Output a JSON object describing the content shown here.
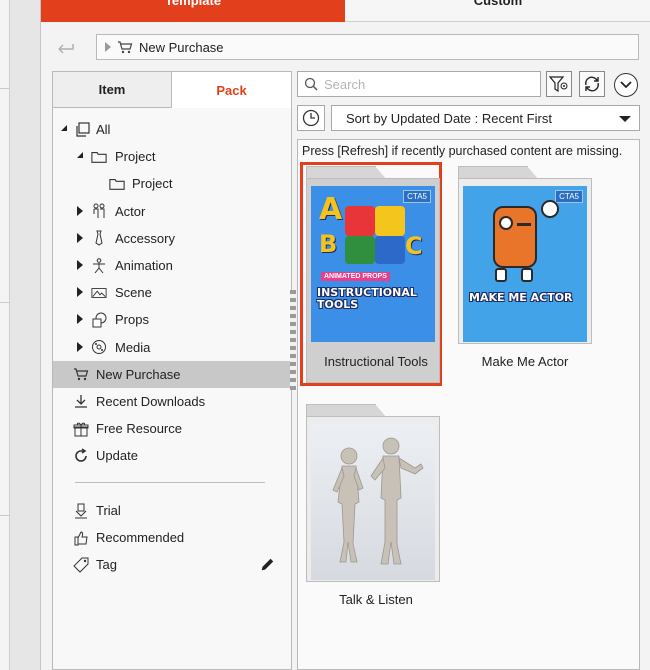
{
  "top_tabs": {
    "template": "Template",
    "custom": "Custom"
  },
  "address": {
    "path": "New Purchase"
  },
  "pane_tabs": {
    "item": "Item",
    "pack": "Pack"
  },
  "tree": {
    "all": "All",
    "project_folder": "Project",
    "project_child": "Project",
    "actor": "Actor",
    "accessory": "Accessory",
    "animation": "Animation",
    "scene": "Scene",
    "props": "Props",
    "media": "Media",
    "new_purchase": "New Purchase",
    "recent_downloads": "Recent Downloads",
    "free_resource": "Free Resource",
    "update": "Update",
    "trial": "Trial",
    "recommended": "Recommended",
    "tag": "Tag"
  },
  "search": {
    "placeholder": "Search"
  },
  "sort": {
    "label": "Sort by Updated Date : Recent First"
  },
  "notice": "Press [Refresh] if recently purchased content are missing.",
  "cards": [
    {
      "name": "Instructional Tools",
      "badge": "CTA5",
      "tag": "ANIMATED PROPS",
      "title": "INSTRUCTIONAL TOOLS",
      "selected": true
    },
    {
      "name": "Make Me Actor",
      "badge": "CTA5",
      "title": "MAKE ME ACTOR"
    },
    {
      "name": "Talk & Listen"
    }
  ],
  "colors": {
    "accent": "#e2401c",
    "selection": "#c8c8c8"
  }
}
